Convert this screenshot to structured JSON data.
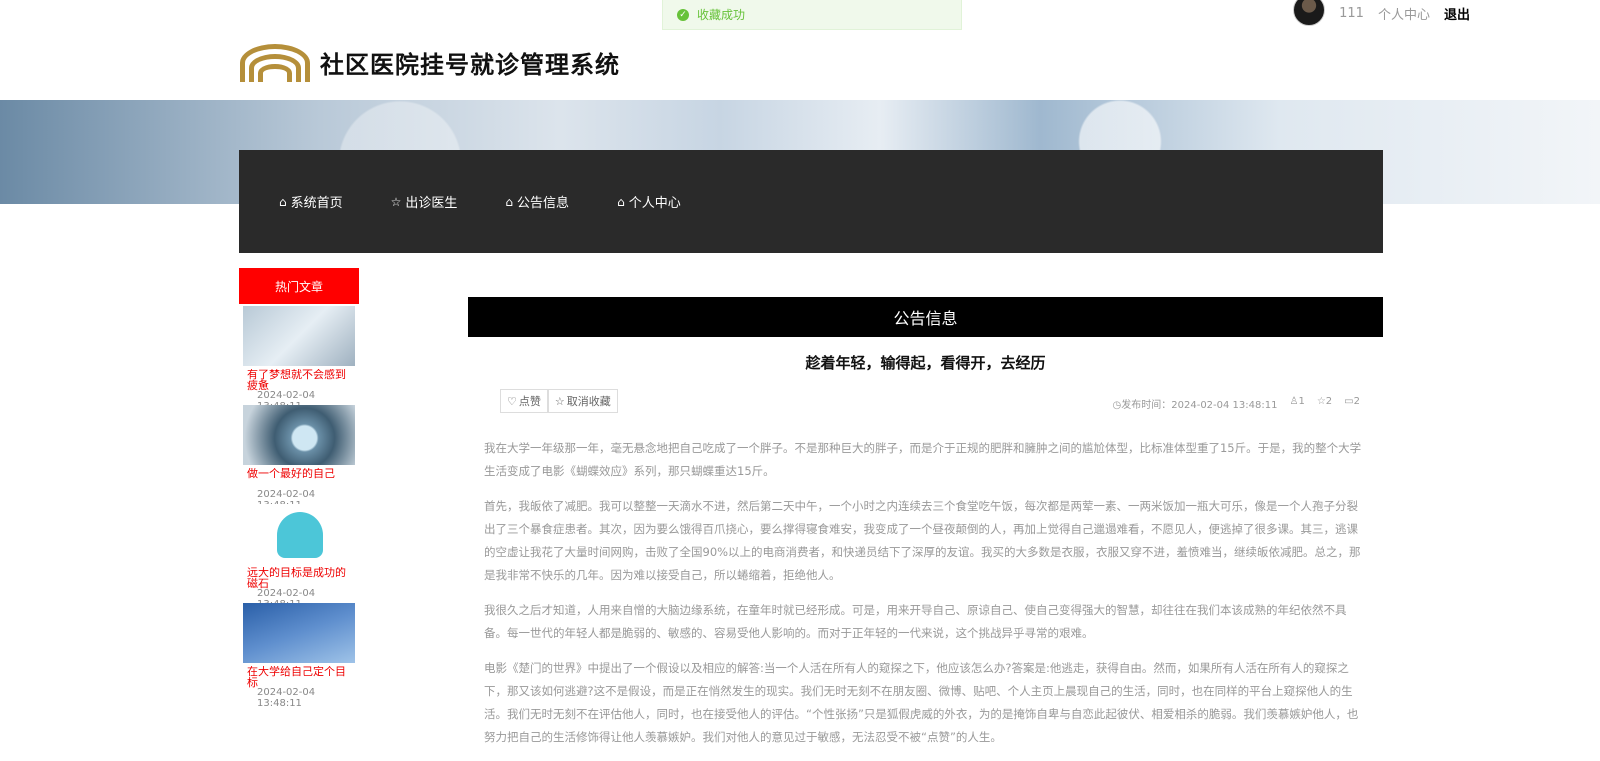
{
  "toast": {
    "text": "收藏成功",
    "icon": "check-circle-icon"
  },
  "user": {
    "name": "111",
    "center_label": "个人中心",
    "logout_label": "退出"
  },
  "site": {
    "title": "社区医院挂号就诊管理系统"
  },
  "nav": [
    {
      "icon": "⌂",
      "label": "系统首页"
    },
    {
      "icon": "☆",
      "label": "出诊医生"
    },
    {
      "icon": "⌂",
      "label": "公告信息"
    },
    {
      "icon": "⌂",
      "label": "个人中心"
    }
  ],
  "sidebar": {
    "heading": "热门文章",
    "items": [
      {
        "title": "有了梦想就不会感到疲惫",
        "date": "2024-02-04 13:48:11"
      },
      {
        "title": "做一个最好的自己",
        "date": "2024-02-04 13:48:11"
      },
      {
        "title": "远大的目标是成功的磁石",
        "date": "2024-02-04 13:48:11"
      },
      {
        "title": "在大学给自己定个目标",
        "date": "2024-02-04 13:48:11"
      }
    ]
  },
  "main": {
    "section_title": "公告信息",
    "article_title": "趁着年轻，输得起，看得开，去经历",
    "like_label": "点赞",
    "unfav_label": "取消收藏",
    "publish_time": "发布时间：2024-02-04 13:48:11",
    "likes": "1",
    "favorites": "2",
    "comments": "2",
    "paragraphs": [
      "我在大学一年级那一年，毫无悬念地把自己吃成了一个胖子。不是那种巨大的胖子，而是介于正规的肥胖和臃肿之间的尴尬体型，比标准体型重了15斤。于是，我的整个大学生活变成了电影《蝴蝶效应》系列，那只蝴蝶重达15斤。",
      "首先，我皈依了减肥。我可以整整一天滴水不进，然后第二天中午，一个小时之内连续去三个食堂吃午饭，每次都是两荤一素、一两米饭加一瓶大可乐，像是一个人孢子分裂出了三个暴食症患者。其次，因为要么饿得百爪挠心，要么撑得寝食难安，我变成了一个昼夜颠倒的人，再加上觉得自己邋遢难看，不愿见人，便逃掉了很多课。其三，逃课的空虚让我花了大量时间网购，击败了全国90%以上的电商消费者，和快递员结下了深厚的友谊。我买的大多数是衣服，衣服又穿不进，羞愤难当，继续皈依减肥。总之，那是我非常不快乐的几年。因为难以接受自己，所以蜷缩着，拒绝他人。",
      "我很久之后才知道，人用来自憎的大脑边缘系统，在童年时就已经形成。可是，用来开导自己、原谅自己、使自己变得强大的智慧，却往往在我们本该成熟的年纪依然不具备。每一世代的年轻人都是脆弱的、敏感的、容易受他人影响的。而对于正年轻的一代来说，这个挑战异乎寻常的艰难。",
      "电影《楚门的世界》中提出了一个假设以及相应的解答:当一个人活在所有人的窥探之下，他应该怎么办?答案是:他逃走，获得自由。然而，如果所有人活在所有人的窥探之下，那又该如何逃避?这不是假设，而是正在悄然发生的现实。我们无时无刻不在朋友圈、微博、贴吧、个人主页上晨现自己的生活，同时，也在同样的平台上窥探他人的生活。我们无时无刻不在评估他人，同时，也在接受他人的评估。“个性张扬”只是狐假虎威的外衣，为的是掩饰自卑与自恋此起彼伏、相爱相杀的脆弱。我们羡慕嫉妒他人，也努力把自己的生活修饰得让他人羡慕嫉妒。我们对他人的意见过于敏感，无法忍受不被“点赞”的人生。"
    ]
  }
}
